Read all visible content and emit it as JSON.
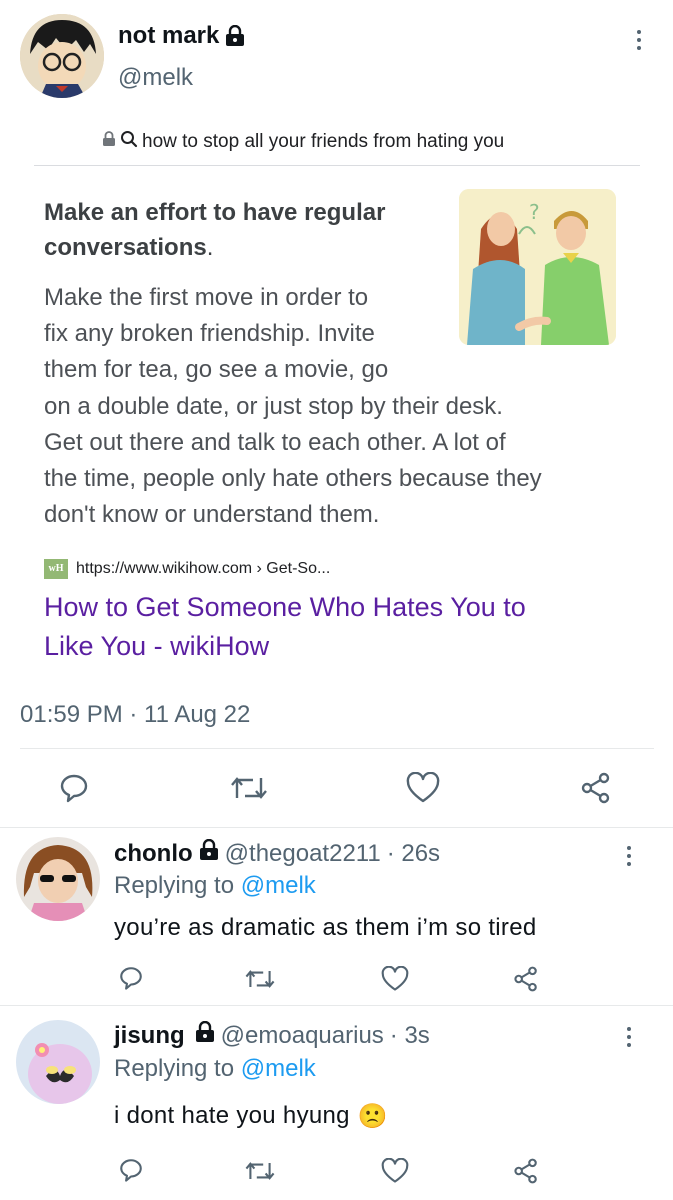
{
  "tweet": {
    "author": {
      "display_name": "not mark",
      "handle": "@melk"
    },
    "screenshot": {
      "search_query": "how to stop all your friends from hating you",
      "heading_bold": "Make an effort to have regular conversations",
      "heading_suffix": ".",
      "body_lines": [
        "Make the first move in order to",
        "fix any broken friendship. Invite",
        "them for tea, go see a movie, go",
        "on a double date, or just stop by their desk.",
        "Get out there and talk to each other. A lot of",
        "the time, people only hate others because they",
        "don't know or understand them."
      ],
      "source_badge": "wH",
      "source_url": "https://www.wikihow.com › Get-So...",
      "result_title_lines": [
        "How to Get Someone Who Hates You to",
        "Like You - wikiHow"
      ]
    },
    "timestamp": "01:59 PM · 11 Aug 22",
    "actions": [
      "reply-icon",
      "retweet-icon",
      "like-icon",
      "share-icon"
    ]
  },
  "replies": [
    {
      "display_name": "chonlo",
      "handle": "@thegoat2211",
      "time": "· 26s",
      "replying_label": "Replying to",
      "replying_to": "@melk",
      "text": "you’re as dramatic as them i’m so tired"
    },
    {
      "display_name": "jisung",
      "handle": "@emoaquarius",
      "time": "· 3s",
      "replying_label": "Replying to",
      "replying_to": "@melk",
      "text": "i dont hate you hyung",
      "emoji": "🙁"
    }
  ],
  "colors": {
    "link": "#1d9bf0",
    "secondary_text": "#536471",
    "divider": "#e7e9ea",
    "result_title": "#5a1fa1"
  }
}
